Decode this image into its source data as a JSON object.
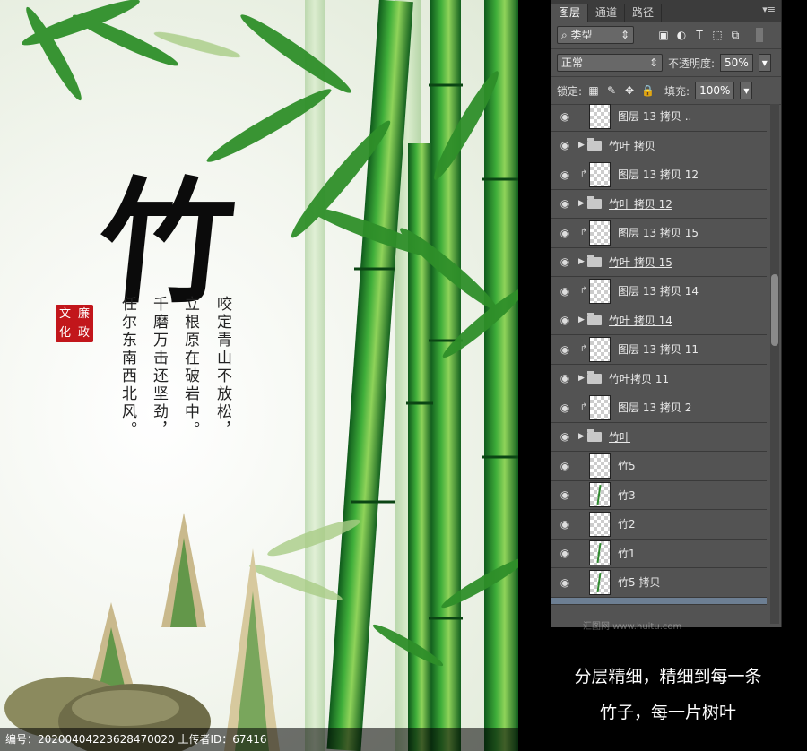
{
  "poster": {
    "title_char": "竹",
    "seal": [
      "文",
      "廉",
      "化",
      "政"
    ],
    "poem_columns": [
      "咬定青山不放松，",
      "立根原在破岩中。",
      "千磨万击还坚劲，",
      "任尔东南西北风。"
    ],
    "footer": "编号：20200404223628470020 上传者ID：67416"
  },
  "panel": {
    "tabs": [
      "图层",
      "通道",
      "路径"
    ],
    "menu_icon": "menu-icon",
    "filter": {
      "label": "⌕ 类型",
      "icons": [
        "image-filter-icon",
        "adjust-filter-icon",
        "text-filter-icon",
        "shape-filter-icon",
        "smart-filter-icon"
      ]
    },
    "blend": {
      "mode": "正常",
      "opacity_label": "不透明度:",
      "opacity_value": "50%"
    },
    "lock": {
      "label": "锁定:",
      "fill_label": "填充:",
      "fill_value": "100%"
    },
    "layers": [
      {
        "type": "layer",
        "name": "图层 13 拷贝 ..",
        "clip": false
      },
      {
        "type": "group",
        "name": "竹叶 拷贝"
      },
      {
        "type": "layer",
        "name": "图层 13 拷贝 12",
        "clip": true
      },
      {
        "type": "group",
        "name": "竹叶 拷贝 12"
      },
      {
        "type": "layer",
        "name": "图层 13 拷贝 15",
        "clip": true
      },
      {
        "type": "group",
        "name": "竹叶 拷贝 15"
      },
      {
        "type": "layer",
        "name": "图层 13 拷贝 14",
        "clip": true
      },
      {
        "type": "group",
        "name": "竹叶 拷贝 14"
      },
      {
        "type": "layer",
        "name": "图层 13 拷贝 11",
        "clip": true
      },
      {
        "type": "group",
        "name": "竹叶拷贝 11"
      },
      {
        "type": "layer",
        "name": "图层 13 拷贝 2",
        "clip": true
      },
      {
        "type": "group",
        "name": "竹叶"
      },
      {
        "type": "layer",
        "name": "竹5",
        "clip": false
      },
      {
        "type": "layer",
        "name": "竹3",
        "clip": false
      },
      {
        "type": "layer",
        "name": "竹2",
        "clip": false
      },
      {
        "type": "layer",
        "name": "竹1",
        "clip": false
      },
      {
        "type": "layer",
        "name": "竹5 拷贝",
        "clip": false
      },
      {
        "type": "selected",
        "name": "",
        "clip": false
      }
    ]
  },
  "caption": [
    "分层精细，精细到每一条",
    "竹子，每一片树叶"
  ],
  "watermark": "汇图网 www.huitu.com"
}
